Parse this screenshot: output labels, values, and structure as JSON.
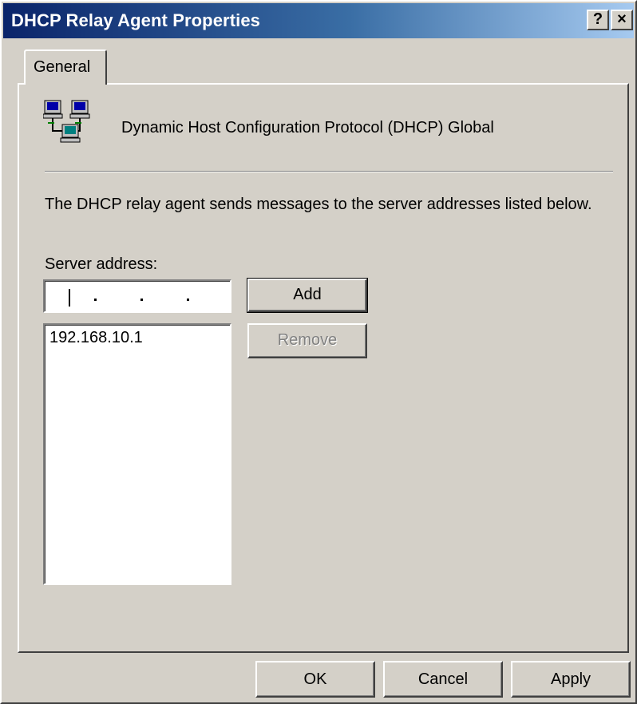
{
  "window": {
    "title": "DHCP Relay Agent Properties",
    "help_glyph": "?",
    "close_glyph": "×"
  },
  "tabs": [
    {
      "label": "General",
      "selected": true
    }
  ],
  "general": {
    "icon": "network-computers-icon",
    "header": "Dynamic Host Configuration Protocol (DHCP) Global",
    "description": "The DHCP relay agent sends messages to the server addresses listed below.",
    "server_address_label": "Server address:",
    "server_address_value": "",
    "server_list": [
      "192.168.10.1"
    ],
    "add_label": "Add",
    "remove_label": "Remove",
    "remove_enabled": false
  },
  "footer": {
    "ok_label": "OK",
    "cancel_label": "Cancel",
    "apply_label": "Apply"
  },
  "colors": {
    "title_start": "#0a246a",
    "title_end": "#a6caf0",
    "face": "#d4d0c8",
    "disabled_text": "#808080"
  }
}
